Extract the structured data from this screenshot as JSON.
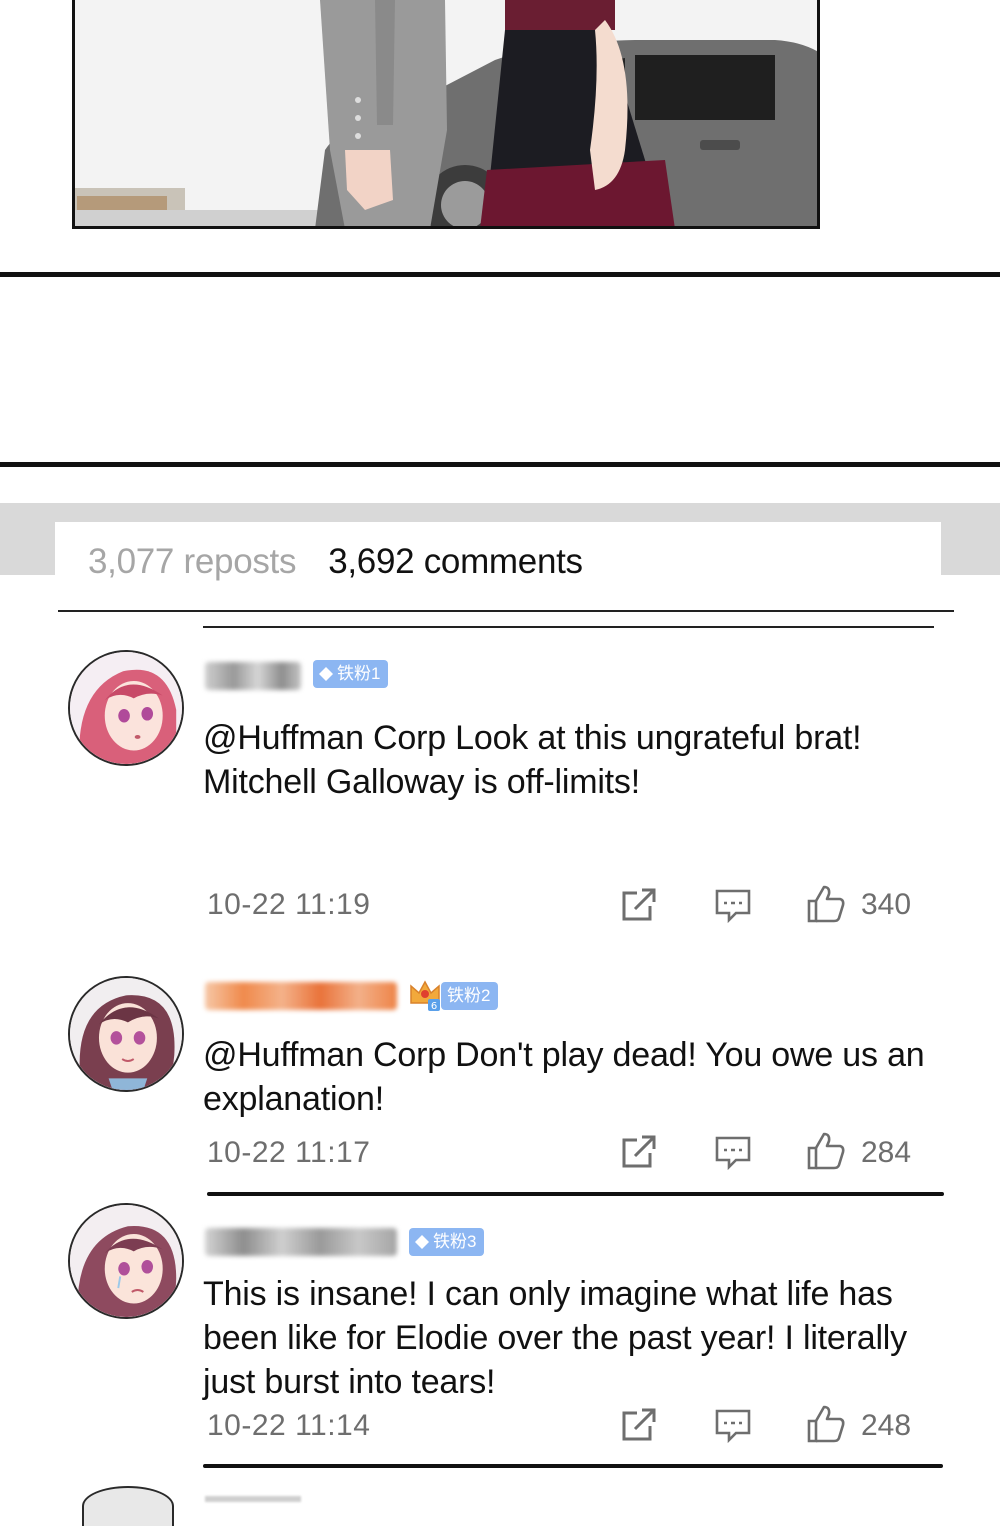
{
  "tabs": {
    "reposts": "3,077 reposts",
    "comments": "3,692 comments"
  },
  "comments": [
    {
      "badge": "铁粉1",
      "text": "@Huffman Corp Look at this ungrateful brat! Mitchell Galloway is off-limits!",
      "time": "10-22 11:19",
      "likes": "340"
    },
    {
      "badge": "铁粉2",
      "crown_level": "6",
      "text": "@Huffman Corp Don't play dead! You owe us an explanation!",
      "time": "10-22 11:17",
      "likes": "284"
    },
    {
      "badge": "铁粉3",
      "text": "This is insane! I can only imagine what life has been like for Elodie over the past year! I literally just burst into tears!",
      "time": "10-22 11:14",
      "likes": "248"
    }
  ],
  "icons": {
    "share": "share-icon",
    "reply": "comment-icon",
    "like": "thumbs-up-icon",
    "badge": "diamond-icon",
    "crown": "crown-icon"
  },
  "colors": {
    "badge_blue": "#8cb6f2",
    "muted_text": "#6e6e6e",
    "inactive_tab": "#a6a6a6"
  }
}
